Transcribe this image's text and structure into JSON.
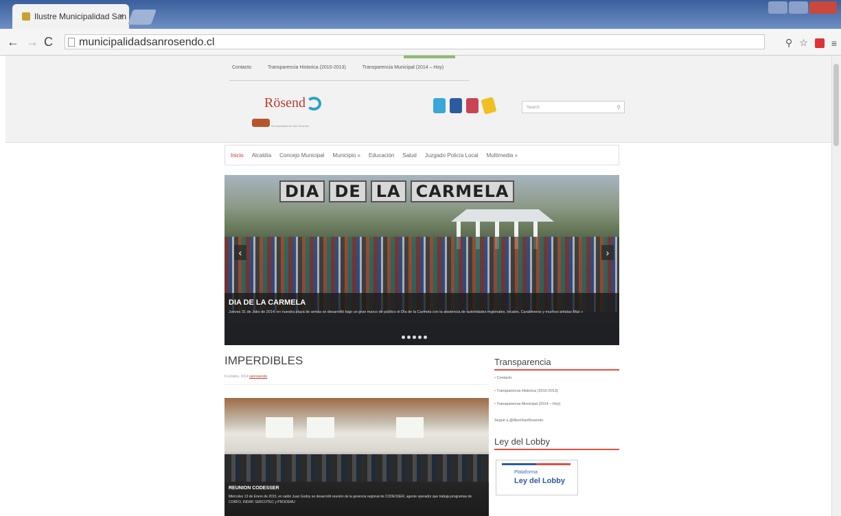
{
  "browser": {
    "tab_title": "Ilustre Municipalidad San",
    "tab_close": "×",
    "url": "municipalidadsanrosendo.cl"
  },
  "header": {
    "top_links": [
      "Contacto",
      "Transparencia Historica (2010-2013)",
      "Transparencia Municipal (2014 – Hoy)"
    ],
    "logo_text": "Rösend",
    "logo_sub": "Municipalidad de San Rosendo",
    "search_placeholder": "Search"
  },
  "menu": {
    "items": [
      "Inicio",
      "Alcaldía",
      "Concejo Municipal",
      "Municipio »",
      "Educación",
      "Salud",
      "Juzgado Policía Local",
      "Multimedia »"
    ]
  },
  "slider": {
    "title_words": [
      "DIA",
      "DE",
      "LA",
      "CARMELA"
    ],
    "caption_title": "DIA DE LA CARMELA",
    "caption_text": "Jueves 31 de Julio de 2014, en nuestra plaza de armas se desarrolló bajo un gran marco de público el Día de la Carmela con la asistencia de autoridades regionales, locales, Carabineros y muchos artistas Más »"
  },
  "content": {
    "title": "IMPERDIBLES",
    "meta_date": "6 octubre, 2014",
    "meta_author": "sanrosendo",
    "post_title": "REUNION CODESSER",
    "post_text": "Miércoles 13 de Enero de 2015, en salón Juan Godoy se desarrolló reunión de la gerencia regional de CODESSER, agente operador que trabaja programas de CORFO, INDAP, SERCOTEC y PRODEMU"
  },
  "sidebar": {
    "transparencia_title": "Transparencia",
    "transparencia_links": [
      "Contacto",
      "Transparencia Historica (2010-2013)",
      "Transparencia Municipal (2014 – Hoy)"
    ],
    "follow_text": "Seguir a @MuniSanRosendo",
    "lobby_title": "Ley del Lobby",
    "lobby_line1": "Plataforma",
    "lobby_line2": "Ley del Lobby"
  }
}
